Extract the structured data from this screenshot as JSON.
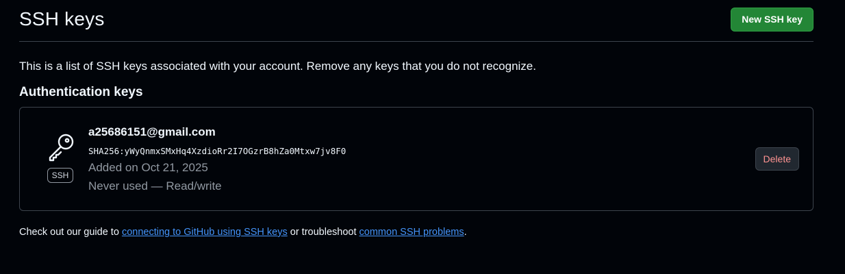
{
  "header": {
    "title": "SSH keys",
    "new_key_label": "New SSH key"
  },
  "intro": "This is a list of SSH keys associated with your account. Remove any keys that you do not recognize.",
  "section": {
    "title": "Authentication keys"
  },
  "key": {
    "icon": "key-icon",
    "badge": "SSH",
    "title": "a25686151@gmail.com",
    "fingerprint": "SHA256:yWyQnmxSMxHq4XzdioRr2I7OGzrB8hZa0Mtxw7jv8F0",
    "added": "Added on Oct 21, 2025",
    "usage": "Never used — Read/write",
    "delete_label": "Delete"
  },
  "footer": {
    "prefix": "Check out our guide to ",
    "link1": "connecting to GitHub using SSH keys",
    "middle": " or troubleshoot ",
    "link2": "common SSH problems",
    "suffix": "."
  },
  "colors": {
    "background": "#010409",
    "primary_button": "#238636",
    "danger_text": "#ff9492",
    "link": "#4493f8",
    "muted_text": "#9198a1"
  }
}
